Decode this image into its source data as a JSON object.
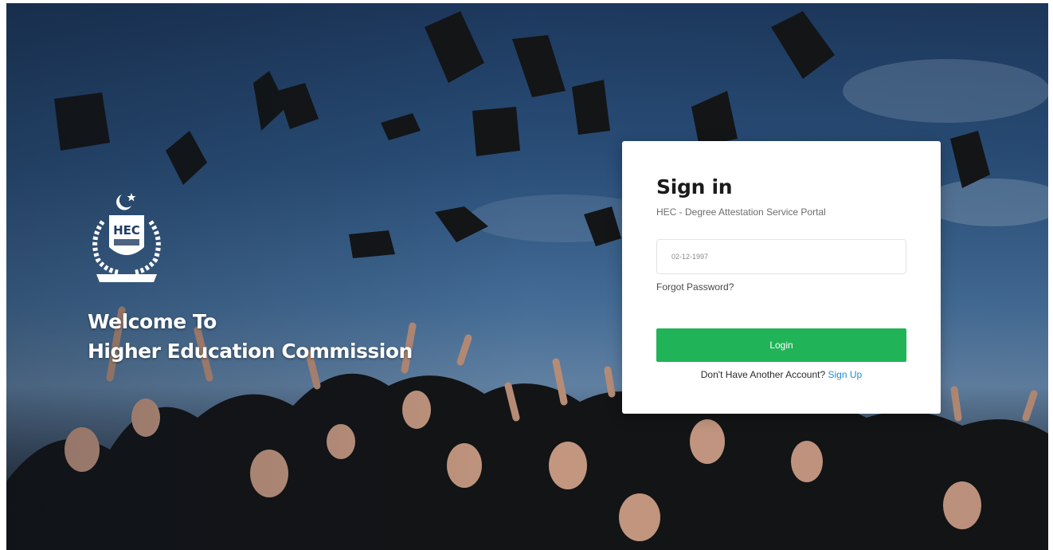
{
  "branding": {
    "welcome_line1": "Welcome To",
    "welcome_line2": "Higher Education Commission",
    "logo_text": "HEC",
    "logo_icon": "hec-emblem-icon"
  },
  "signin": {
    "title": "Sign in",
    "subtitle": "HEC - Degree Attestation Service Portal",
    "field_value": "02-12-1997",
    "forgot_label": "Forgot Password?",
    "login_label": "Login",
    "account_prompt": "Don't Have Another Account?",
    "signup_label": "Sign Up"
  },
  "colors": {
    "login_button": "#21b358",
    "signup_link": "#1f8fd4",
    "card_background": "#ffffff"
  }
}
